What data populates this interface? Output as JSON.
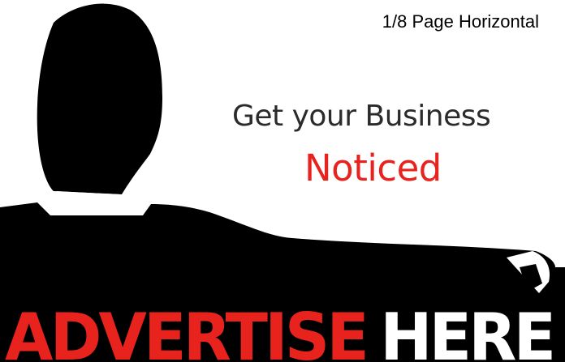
{
  "ad": {
    "size_label": "1/8 Page Horizontal",
    "headline": "Get your Business",
    "headline_accent": "Noticed",
    "banner_word_1": "ADVERTISE",
    "banner_word_2": "HERE"
  },
  "colors": {
    "accent_red": "#e8231e",
    "silhouette": "#000000",
    "text_dark": "#2b2b2b",
    "background": "#ffffff"
  },
  "image": {
    "subject_icon": "man-silhouette-icon"
  }
}
